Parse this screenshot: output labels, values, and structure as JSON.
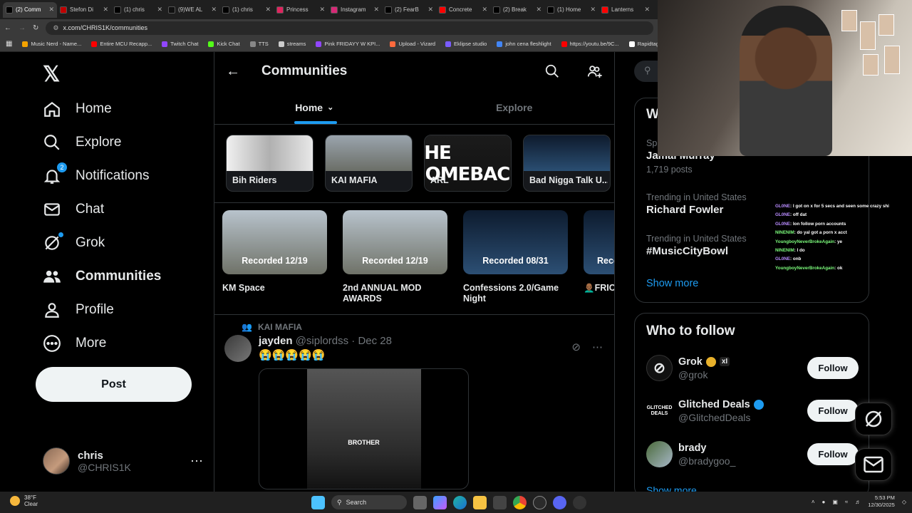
{
  "browser": {
    "tabs": [
      {
        "label": "(2) Comm",
        "color": "#000000",
        "active": true
      },
      {
        "label": "Stefon Di",
        "color": "#c00000"
      },
      {
        "label": "(1) chris",
        "color": "#000000"
      },
      {
        "label": "(9)WE AL",
        "color": "#111111"
      },
      {
        "label": "(1) chris",
        "color": "#000000"
      },
      {
        "label": "Princess",
        "color": "#e0245e"
      },
      {
        "label": "Instagram",
        "color": "#d62976"
      },
      {
        "label": "(2) FearB",
        "color": "#000000"
      },
      {
        "label": "Concrete",
        "color": "#ff0000"
      },
      {
        "label": "(2) Break",
        "color": "#000000"
      },
      {
        "label": "(1) Home",
        "color": "#000000"
      },
      {
        "label": "Lanterns",
        "color": "#ff0000"
      }
    ],
    "url": "x.com/CHRIS1K/communities",
    "bookmarks": [
      {
        "label": "Music Nerd - Name...",
        "color": "#f4a300"
      },
      {
        "label": "Entire MCU Recapp...",
        "color": "#ff0000"
      },
      {
        "label": "Twitch Chat",
        "color": "#9146ff"
      },
      {
        "label": "Kick Chat",
        "color": "#53fc18"
      },
      {
        "label": "TTS",
        "color": "#888888"
      },
      {
        "label": "streams",
        "color": "#cccccc"
      },
      {
        "label": "Pink FRIDAYY W KPI...",
        "color": "#9146ff"
      },
      {
        "label": "Upload - Vizard",
        "color": "#ff6a3d"
      },
      {
        "label": "Eklipse studio",
        "color": "#7a5cff"
      },
      {
        "label": "john cena fleshlight",
        "color": "#4285f4"
      },
      {
        "label": "https://youtu.be/9C...",
        "color": "#ff0000"
      },
      {
        "label": "Rapidtags | You",
        "color": "#ffffff"
      }
    ]
  },
  "nav": {
    "items": [
      {
        "label": "Home",
        "icon": "home-icon"
      },
      {
        "label": "Explore",
        "icon": "search-icon"
      },
      {
        "label": "Notifications",
        "icon": "bell-icon",
        "badge": "2"
      },
      {
        "label": "Chat",
        "icon": "mail-icon"
      },
      {
        "label": "Grok",
        "icon": "grok-icon"
      },
      {
        "label": "Communities",
        "icon": "communities-icon"
      },
      {
        "label": "Profile",
        "icon": "profile-icon"
      },
      {
        "label": "More",
        "icon": "more-circle-icon"
      }
    ],
    "post_label": "Post",
    "account": {
      "name": "chris",
      "handle": "@CHRIS1K"
    }
  },
  "center": {
    "title": "Communities",
    "tabs": [
      {
        "label": "Home"
      },
      {
        "label": "Explore"
      }
    ],
    "communities": [
      {
        "label": "Bih Riders"
      },
      {
        "label": "KAI MAFIA"
      },
      {
        "label": "ARL",
        "art": "THE COMEBACK"
      },
      {
        "label": "Bad Nigga Talk U..."
      }
    ],
    "spaces": [
      {
        "recorded": "Recorded 12/19",
        "title": "KM Space"
      },
      {
        "recorded": "Recorded 12/19",
        "title": "2nd ANNUAL MOD AWARDS"
      },
      {
        "recorded": "Recorded 08/31",
        "title": "Confessions 2.0/Game Night"
      },
      {
        "recorded": "Reco",
        "title": "👨🏾‍🦲FRIC Nigga T"
      }
    ],
    "post": {
      "community": "KAI MAFIA",
      "name": "jayden",
      "handle": "@siplordss",
      "date": "· Dec 28",
      "text": "😭😭😭😭😭",
      "media_caption": "BROTHER"
    }
  },
  "right": {
    "trends_heading": "W",
    "trends": [
      {
        "kind": "Sp",
        "name": "Jamal Murray",
        "posts": "1,719 posts"
      },
      {
        "kind": "Trending in United States",
        "name": "Richard Fowler"
      },
      {
        "kind": "Trending in United States",
        "name": "#MusicCityBowl"
      }
    ],
    "show_more": "Show more",
    "who_to_follow": "Who to follow",
    "follow_suggestions": [
      {
        "name": "Grok",
        "handle": "@grok",
        "badge_color": "#e8b12b",
        "tag": "xI"
      },
      {
        "name": "Glitched Deals",
        "handle": "@GlitchedDeals",
        "badge_color": "#1d9bf0",
        "avatar_text": "GLITCHED DEALS"
      },
      {
        "name": "brady",
        "handle": "@bradygoo_"
      }
    ],
    "follow_label": "Follow",
    "show_more_2": "Show more"
  },
  "stream_chat": [
    {
      "user": "GL0NE",
      "msg": ": I got on x for 5 secs and seen some crazy shi",
      "color": "#b98cff"
    },
    {
      "user": "GL0NE",
      "msg": ": off dat",
      "color": "#b98cff"
    },
    {
      "user": "GL0NE",
      "msg": ": Ion follow porn accounts",
      "color": "#b98cff"
    },
    {
      "user": "NINENIM",
      "msg": ": do yal got a porn x acct",
      "color": "#7CFC7C"
    },
    {
      "user": "YoungboyNeverBrokeAgain",
      "msg": ": ye",
      "color": "#7CFC7C"
    },
    {
      "user": "NINENIM",
      "msg": ": I do",
      "color": "#7CFC7C"
    },
    {
      "user": "GL0NE",
      "msg": ": onb",
      "color": "#b98cff"
    },
    {
      "user": "YoungboyNeverBrokeAgain",
      "msg": ": ok",
      "color": "#7CFC7C"
    }
  ],
  "taskbar": {
    "temp": "38°F",
    "condition": "Clear",
    "search": "Search",
    "time": "5:53 PM",
    "date": "12/30/2025"
  }
}
